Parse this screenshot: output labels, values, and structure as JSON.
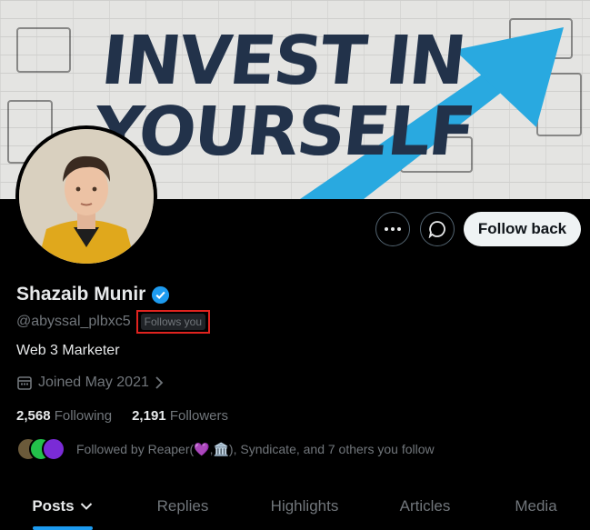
{
  "banner": {
    "line1": "INVEST IN",
    "line2": "YOURSELF"
  },
  "profile": {
    "name": "Shazaib Munir",
    "handle": "@abyssal_plbxc5",
    "follows_you": "Follows you",
    "bio": "Web 3 Marketer",
    "joined": "Joined May 2021",
    "following_count": "2,568",
    "following_label": "Following",
    "followers_count": "2,191",
    "followers_label": "Followers",
    "followed_by": "Followed by Reaper(💜,🏛️), Syndicate, and 7 others you follow"
  },
  "actions": {
    "follow_back": "Follow back"
  },
  "tabs": [
    {
      "label": "Posts"
    },
    {
      "label": "Replies"
    },
    {
      "label": "Highlights"
    },
    {
      "label": "Articles"
    },
    {
      "label": "Media"
    }
  ],
  "colors": {
    "accent": "#1d9bf0",
    "verified": "#1d9bf0",
    "highlight_box": "#e0231f"
  }
}
